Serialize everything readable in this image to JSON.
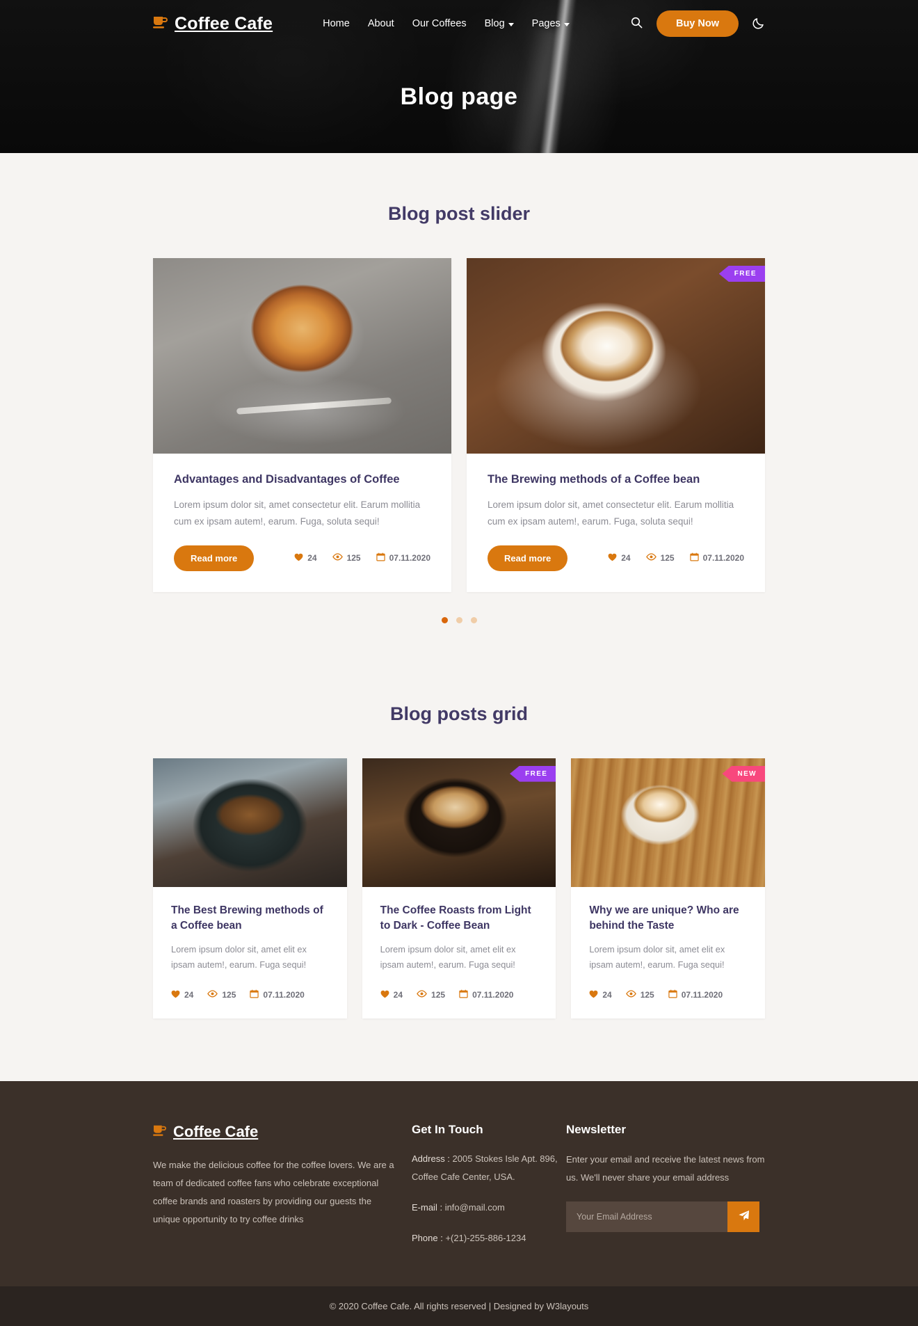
{
  "header": {
    "brand": "Coffee Cafe",
    "brand_icon": "coffee-cup-icon",
    "nav": [
      {
        "label": "Home",
        "has_caret": false
      },
      {
        "label": "About",
        "has_caret": false
      },
      {
        "label": "Our Coffees",
        "has_caret": false
      },
      {
        "label": "Blog",
        "has_caret": true
      },
      {
        "label": "Pages",
        "has_caret": true
      }
    ],
    "search_icon": "search-icon",
    "buy_now": "Buy Now",
    "theme_toggle_icon": "moon-icon",
    "page_title": "Blog page"
  },
  "slider": {
    "title": "Blog post slider",
    "cards": [
      {
        "badge": null,
        "title": "Advantages and Disadvantages of Coffee",
        "text": "Lorem ipsum dolor sit, amet consectetur elit. Earum mollitia cum ex ipsam autem!, earum. Fuga, soluta sequi!",
        "button": "Read more",
        "likes": "24",
        "views": "125",
        "date": "07.11.2020"
      },
      {
        "badge": "FREE",
        "badge_color": "#9b3ff0",
        "title": "The Brewing methods of a Coffee bean",
        "text": "Lorem ipsum dolor sit, amet consectetur elit. Earum mollitia cum ex ipsam autem!, earum. Fuga, soluta sequi!",
        "button": "Read more",
        "likes": "24",
        "views": "125",
        "date": "07.11.2020"
      }
    ],
    "dots": [
      {
        "active": true
      },
      {
        "active": false
      },
      {
        "active": false
      }
    ]
  },
  "grid": {
    "title": "Blog posts grid",
    "cards": [
      {
        "badge": null,
        "title": "The Best Brewing methods of a Coffee bean",
        "text": "Lorem ipsum dolor sit, amet elit ex ipsam autem!, earum. Fuga sequi!",
        "likes": "24",
        "views": "125",
        "date": "07.11.2020"
      },
      {
        "badge": "FREE",
        "badge_color": "#9b3ff0",
        "title": "The Coffee Roasts from Light to Dark - Coffee Bean",
        "text": "Lorem ipsum dolor sit, amet elit ex ipsam autem!, earum. Fuga sequi!",
        "likes": "24",
        "views": "125",
        "date": "07.11.2020"
      },
      {
        "badge": "NEW",
        "badge_color": "#f8487d",
        "title": "Why we are unique? Who are behind the Taste",
        "text": "Lorem ipsum dolor sit, amet elit ex ipsam autem!, earum. Fuga sequi!",
        "likes": "24",
        "views": "125",
        "date": "07.11.2020"
      }
    ]
  },
  "footer": {
    "brand": "Coffee Cafe",
    "about": "We make the delicious coffee for the coffee lovers. We are a team of dedicated coffee fans who celebrate exceptional coffee brands and roasters by providing our guests the unique opportunity to try coffee drinks",
    "touch": {
      "heading": "Get In Touch",
      "address_label": "Address :",
      "address_value": "2005 Stokes Isle Apt. 896, Coffee Cafe Center, USA.",
      "email_label": "E-mail :",
      "email_value": "info@mail.com",
      "phone_label": "Phone :",
      "phone_value": "+(21)-255-886-1234"
    },
    "newsletter": {
      "heading": "Newsletter",
      "text": "Enter your email and receive the latest news from us. We'll never share your email address",
      "placeholder": "Your Email Address",
      "value": "",
      "submit_icon": "paper-plane-icon"
    },
    "copyright": "© 2020 Coffee Cafe. All rights reserved | Designed by W3layouts"
  },
  "colors": {
    "accent": "#d9780f",
    "heading": "#423a66",
    "footer_bg": "#3b3029",
    "copyright_bg": "#2b2420"
  }
}
